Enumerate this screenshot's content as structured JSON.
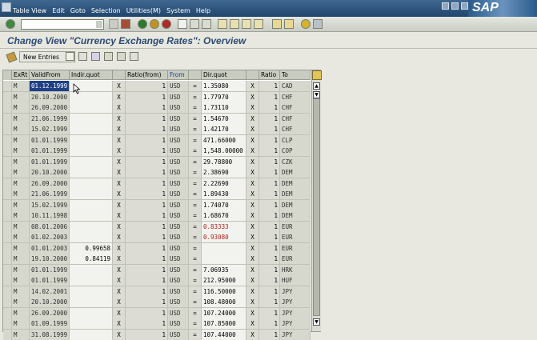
{
  "menu": [
    "Table View",
    "Edit",
    "Goto",
    "Selection",
    "Utilities(M)",
    "System",
    "Help"
  ],
  "logo": "SAP",
  "page_title": "Change View \"Currency Exchange Rates\": Overview",
  "app_toolbar": {
    "new_entries": "New Entries"
  },
  "table": {
    "headers": {
      "exrt": "ExRt",
      "valid_from": "ValidFrom",
      "indir": "Indir.quot",
      "x1": "",
      "ratio_from": "Ratio(from)",
      "from": "From",
      "eq": "",
      "dir": "Dir.quot",
      "x2": "",
      "ratio": "Ratio",
      "to": "To"
    },
    "rows": [
      {
        "exrt": "M",
        "valid": "01.12.1999",
        "indir": "",
        "ratio_from": "1",
        "from": "USD",
        "eq": "=",
        "dir": "1.35080",
        "ratio": "1",
        "to": "CAD",
        "selected": true
      },
      {
        "exrt": "M",
        "valid": "20.10.2000",
        "indir": "",
        "ratio_from": "1",
        "from": "USD",
        "eq": "=",
        "dir": "1.77970",
        "ratio": "1",
        "to": "CHF"
      },
      {
        "exrt": "M",
        "valid": "26.09.2000",
        "indir": "",
        "ratio_from": "1",
        "from": "USD",
        "eq": "=",
        "dir": "1.73110",
        "ratio": "1",
        "to": "CHF"
      },
      {
        "exrt": "M",
        "valid": "21.06.1999",
        "indir": "",
        "ratio_from": "1",
        "from": "USD",
        "eq": "=",
        "dir": "1.54670",
        "ratio": "1",
        "to": "CHF"
      },
      {
        "exrt": "M",
        "valid": "15.02.1999",
        "indir": "",
        "ratio_from": "1",
        "from": "USD",
        "eq": "=",
        "dir": "1.42170",
        "ratio": "1",
        "to": "CHF"
      },
      {
        "exrt": "M",
        "valid": "01.01.1999",
        "indir": "",
        "ratio_from": "1",
        "from": "USD",
        "eq": "=",
        "dir": "471.66000",
        "ratio": "1",
        "to": "CLP"
      },
      {
        "exrt": "M",
        "valid": "01.01.1999",
        "indir": "",
        "ratio_from": "1",
        "from": "USD",
        "eq": "=",
        "dir": "1,548.00000",
        "ratio": "1",
        "to": "COP"
      },
      {
        "exrt": "M",
        "valid": "01.01.1999",
        "indir": "",
        "ratio_from": "1",
        "from": "USD",
        "eq": "=",
        "dir": "29.78800",
        "ratio": "1",
        "to": "CZK"
      },
      {
        "exrt": "M",
        "valid": "20.10.2000",
        "indir": "",
        "ratio_from": "1",
        "from": "USD",
        "eq": "=",
        "dir": "2.38690",
        "ratio": "1",
        "to": "DEM"
      },
      {
        "exrt": "M",
        "valid": "26.09.2000",
        "indir": "",
        "ratio_from": "1",
        "from": "USD",
        "eq": "=",
        "dir": "2.22690",
        "ratio": "1",
        "to": "DEM"
      },
      {
        "exrt": "M",
        "valid": "21.06.1999",
        "indir": "",
        "ratio_from": "1",
        "from": "USD",
        "eq": "=",
        "dir": "1.89430",
        "ratio": "1",
        "to": "DEM"
      },
      {
        "exrt": "M",
        "valid": "15.02.1999",
        "indir": "",
        "ratio_from": "1",
        "from": "USD",
        "eq": "=",
        "dir": "1.74070",
        "ratio": "1",
        "to": "DEM"
      },
      {
        "exrt": "M",
        "valid": "10.11.1998",
        "indir": "",
        "ratio_from": "1",
        "from": "USD",
        "eq": "=",
        "dir": "1.68670",
        "ratio": "1",
        "to": "DEM"
      },
      {
        "exrt": "M",
        "valid": "08.01.2006",
        "indir": "",
        "ratio_from": "1",
        "from": "USD",
        "eq": "=",
        "dir": "0.83333",
        "ratio": "1",
        "to": "EUR",
        "red": true
      },
      {
        "exrt": "M",
        "valid": "01.02.2003",
        "indir": "",
        "ratio_from": "1",
        "from": "USD",
        "eq": "=",
        "dir": "0.93080",
        "ratio": "1",
        "to": "EUR",
        "red": true
      },
      {
        "exrt": "M",
        "valid": "01.01.2003",
        "indir": "0.99658",
        "ratio_from": "1",
        "from": "USD",
        "eq": "=",
        "dir": "",
        "ratio": "1",
        "to": "EUR"
      },
      {
        "exrt": "M",
        "valid": "19.10.2000",
        "indir": "0.84119",
        "ratio_from": "1",
        "from": "USD",
        "eq": "=",
        "dir": "",
        "ratio": "1",
        "to": "EUR"
      },
      {
        "exrt": "M",
        "valid": "01.01.1999",
        "indir": "",
        "ratio_from": "1",
        "from": "USD",
        "eq": "=",
        "dir": "7.06935",
        "ratio": "1",
        "to": "HRK"
      },
      {
        "exrt": "M",
        "valid": "01.01.1999",
        "indir": "",
        "ratio_from": "1",
        "from": "USD",
        "eq": "=",
        "dir": "212.95000",
        "ratio": "1",
        "to": "HUF"
      },
      {
        "exrt": "M",
        "valid": "14.02.2001",
        "indir": "",
        "ratio_from": "1",
        "from": "USD",
        "eq": "=",
        "dir": "116.50000",
        "ratio": "1",
        "to": "JPY"
      },
      {
        "exrt": "M",
        "valid": "20.10.2000",
        "indir": "",
        "ratio_from": "1",
        "from": "USD",
        "eq": "=",
        "dir": "108.48000",
        "ratio": "1",
        "to": "JPY"
      },
      {
        "exrt": "M",
        "valid": "26.09.2000",
        "indir": "",
        "ratio_from": "1",
        "from": "USD",
        "eq": "=",
        "dir": "107.24000",
        "ratio": "1",
        "to": "JPY"
      },
      {
        "exrt": "M",
        "valid": "01.09.1999",
        "indir": "",
        "ratio_from": "1",
        "from": "USD",
        "eq": "=",
        "dir": "107.85000",
        "ratio": "1",
        "to": "JPY"
      },
      {
        "exrt": "M",
        "valid": "31.08.1999",
        "indir": "",
        "ratio_from": "1",
        "from": "USD",
        "eq": "=",
        "dir": "107.44000",
        "ratio": "1",
        "to": "JPY"
      }
    ],
    "x_mark": "X"
  },
  "scroll_up": "▲",
  "scroll_down": "▼"
}
